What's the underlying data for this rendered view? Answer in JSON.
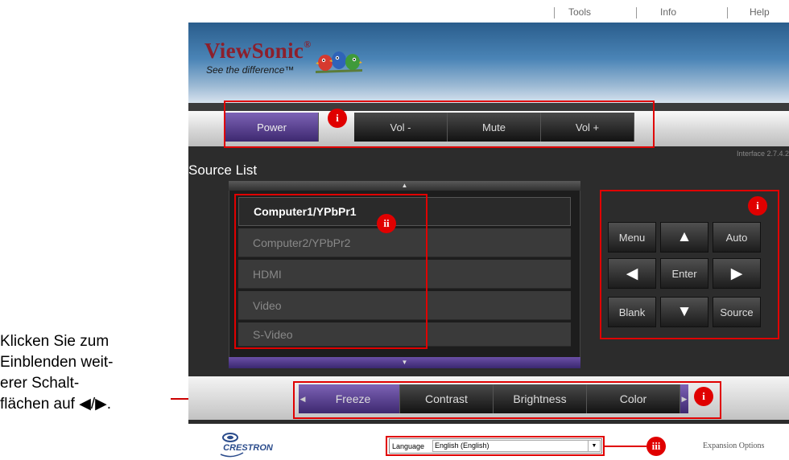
{
  "caption": {
    "lines": [
      "Klicken Sie zum",
      "Einblenden weit-",
      "erer Schalt-",
      "flächen auf ◀/▶."
    ]
  },
  "topnav": {
    "tools": "Tools",
    "info": "Info",
    "help": "Help"
  },
  "brand": {
    "name": "ViewSonic",
    "registered": "®",
    "tagline": "See the difference™"
  },
  "toolbar": {
    "power": "Power",
    "vol_minus": "Vol -",
    "mute": "Mute",
    "vol_plus": "Vol +"
  },
  "interface_version": "Interface 2.7.4.2",
  "source_list": {
    "title": "Source List",
    "scroll_up": "▲",
    "scroll_down": "▼",
    "items": [
      "Computer1/YPbPr1",
      "Computer2/YPbPr2",
      "HDMI",
      "Video",
      "S-Video"
    ],
    "selected": "Computer1/YPbPr1"
  },
  "control_pad": {
    "menu": "Menu",
    "auto": "Auto",
    "enter": "Enter",
    "blank": "Blank",
    "source": "Source",
    "up": "▲",
    "down": "▼",
    "left": "◀",
    "right": "▶"
  },
  "lower_toolbar": {
    "freeze": "Freeze",
    "contrast": "Contrast",
    "brightness": "Brightness",
    "color": "Color",
    "left_arrow": "◀",
    "right_arrow": "▶"
  },
  "footer": {
    "crestron": "CRESTRON",
    "language_label": "Language",
    "language_value": "English (English)",
    "dropdown_arrow": "▼",
    "expansion": "Expansion Options"
  },
  "annotations": {
    "badge_i": "i",
    "badge_ii": "ii",
    "badge_iii": "iii"
  },
  "colors": {
    "accent_purple": "#5a3f96",
    "annotation_red": "#e00000",
    "brand_red": "#8c1f2c"
  }
}
